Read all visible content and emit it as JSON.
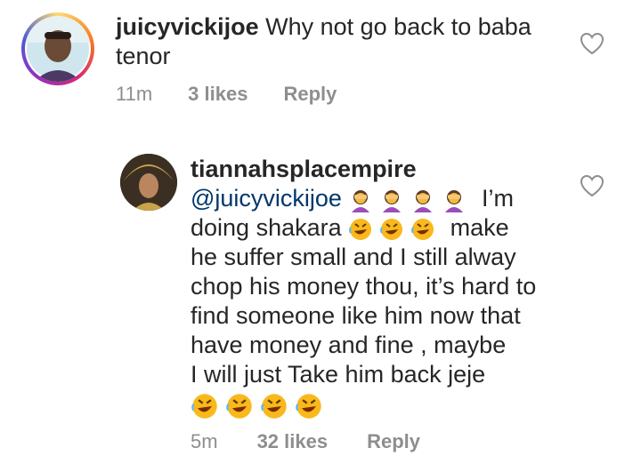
{
  "comment1": {
    "username": "juicyvickijoe",
    "text_line1": "Why not go back to baba",
    "text_line2": "tenor",
    "time": "11m",
    "likes": "3 likes",
    "reply": "Reply",
    "avatar_icon": "profile-photo-icon"
  },
  "comment2": {
    "username": "tiannahsplacempire",
    "mention": "@juicyvickijoe",
    "text_line1_after": "I’m",
    "text_line2_start": "doing shakara",
    "text_line2_end": "make",
    "text_line3": "he suffer small and I still alway",
    "text_line4": "chop his money thou, it’s hard to",
    "text_line5": "find someone like him now that",
    "text_line6": "have money and fine , maybe",
    "text_line7": "I will just Take him back jeje",
    "time": "5m",
    "likes": "32 likes",
    "reply": "Reply",
    "avatar_icon": "profile-photo-icon"
  },
  "icons": {
    "like": "heart-outline-icon",
    "facepalm": "woman-facepalming-emoji",
    "laugh": "rolling-on-floor-laughing-emoji"
  },
  "colors": {
    "text": "#262626",
    "meta": "#8e8e8e",
    "mention": "#00376b"
  }
}
